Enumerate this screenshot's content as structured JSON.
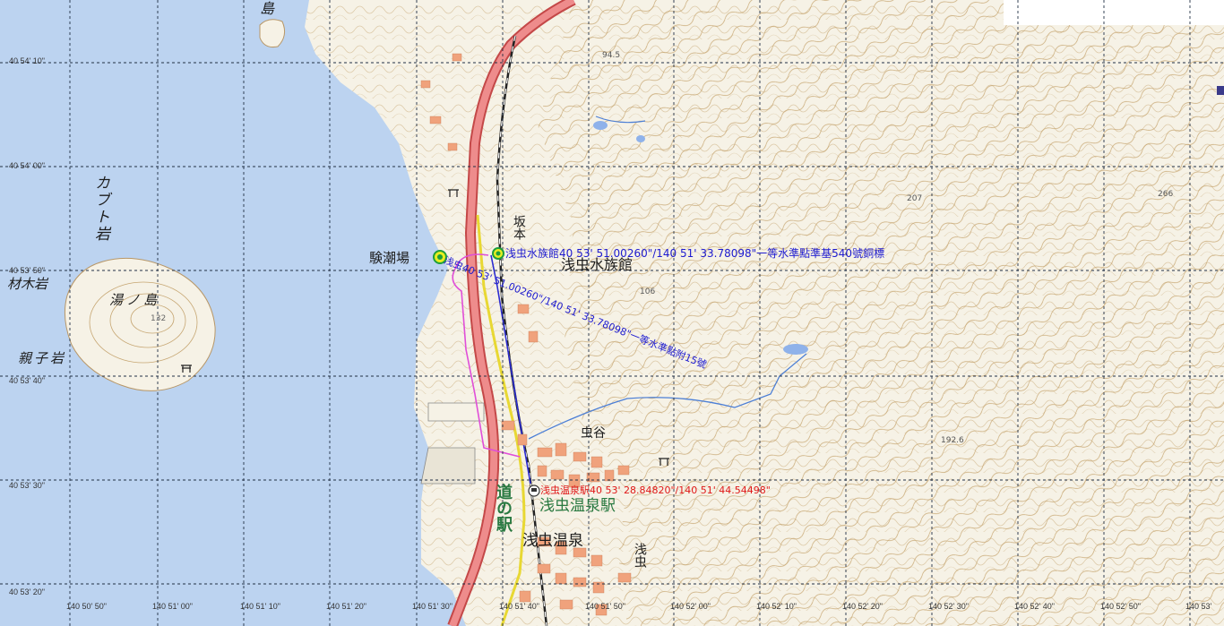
{
  "colors": {
    "sea": "#bcd3f0",
    "land": "#f6f2e6",
    "contour": "#c6a672",
    "grid": "#223045",
    "road_main": "#e66a6a",
    "road_yellow": "#f2e34a",
    "route_magenta": "#e04ed8",
    "route_blue": "#2b2bd0",
    "stream": "#4c7fd6",
    "building": "#f0a27c",
    "marker_green": "#1e9e3c",
    "marker_yellow": "#e8ee20"
  },
  "grid_labels": {
    "lat": [
      "40 54' 10\"",
      "40 54' 00\"",
      "40 53' 50\"",
      "40 53' 40\"",
      "40 53' 30\"",
      "40 53' 20\""
    ],
    "lon": [
      "140 50' 50\"",
      "140 51' 00\"",
      "140 51' 10\"",
      "140 51' 20\"",
      "140 51' 30\"",
      "140 51' 40\"",
      "140 51' 50\"",
      "140 52' 00\"",
      "140 52' 10\"",
      "140 52' 20\"",
      "140 52' 30\"",
      "140 52' 40\"",
      "140 52' 50\"",
      "140 53'"
    ]
  },
  "place_labels": {
    "shima_top": "島",
    "kabuto_iwa": "カブト岩",
    "zaimoku_iwa": "材木岩",
    "yunoshima": "湯ノ島",
    "oyako_iwa": "親子岩",
    "elev_132": "132",
    "kenchoujou": "験潮場",
    "sakamoto": "坂本",
    "aquarium_map": "浅虫水族館",
    "elev_106": "106",
    "elev_207": "207",
    "elev_266": "266",
    "elev_245": "94.5",
    "elev_1926": "192.6",
    "mushiya": "虫谷",
    "michinoeki": "道の駅",
    "station_map": "浅虫温泉駅",
    "onsen_area": "浅虫温泉",
    "asamushi": "浅虫"
  },
  "annotations": {
    "aquarium": "浅虫水族館40 53' 51.00260\"/140 51' 33.78098\"一等水準點準基540號銅標",
    "benchmark_diag": "浅虫40 53' 51.00260\"/140 51' 33.78098\"一等水準點附15號",
    "station": "浅虫温泉駅40 53' 28.84820\"/140 51' 44.54498\""
  },
  "icons": [
    "marker-green-icon",
    "marker-station-icon",
    "shrine-icon",
    "shrine-icon-2",
    "shrine-icon-3"
  ]
}
